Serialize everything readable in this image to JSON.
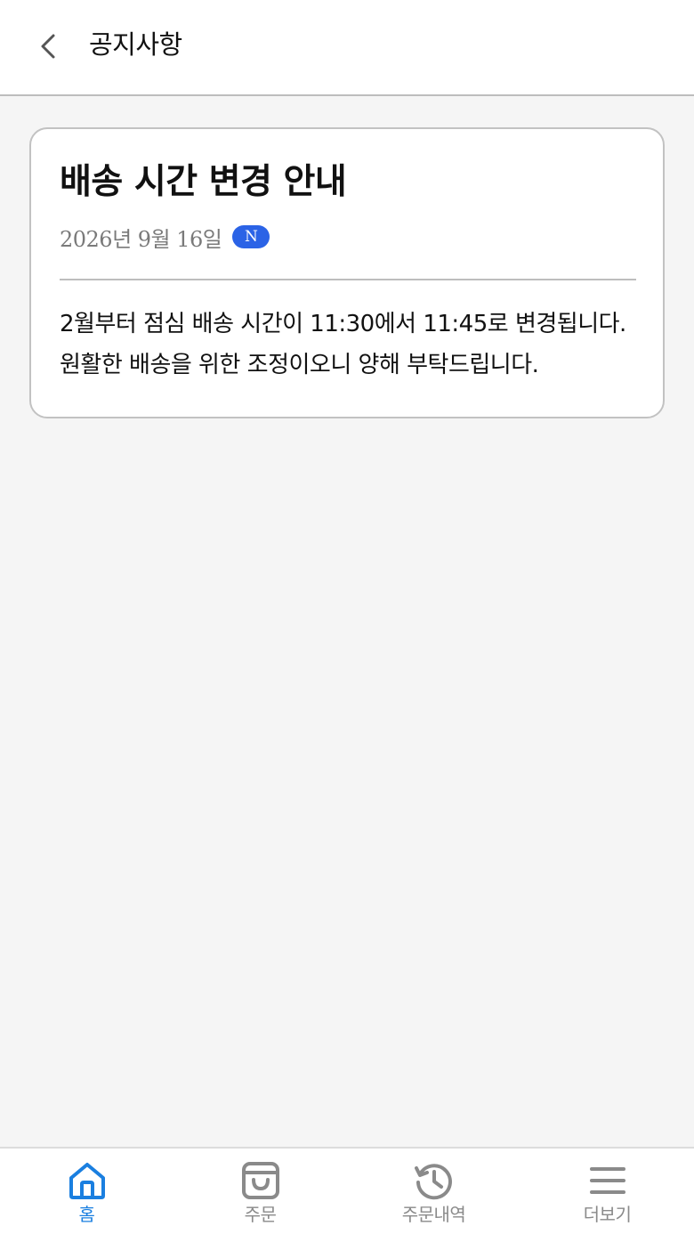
{
  "header": {
    "title": "공지사항"
  },
  "notice": {
    "title": "배송 시간 변경 안내",
    "date": "2026년 9월 16일",
    "badge": "N",
    "body": "2월부터 점심 배송 시간이 11:30에서 11:45로 변경됩니다. 원활한 배송을 위한 조정이오니 양해 부탁드립니다."
  },
  "nav": {
    "items": [
      {
        "label": "홈",
        "icon": "home-icon",
        "active": true
      },
      {
        "label": "주문",
        "icon": "shopping-bag-icon",
        "active": false
      },
      {
        "label": "주문내역",
        "icon": "history-icon",
        "active": false
      },
      {
        "label": "더보기",
        "icon": "menu-icon",
        "active": false
      }
    ]
  },
  "colors": {
    "accent": "#1a7fe0",
    "badge": "#2b63e6",
    "inactive": "#8a8a8a",
    "background": "#f5f5f5"
  }
}
